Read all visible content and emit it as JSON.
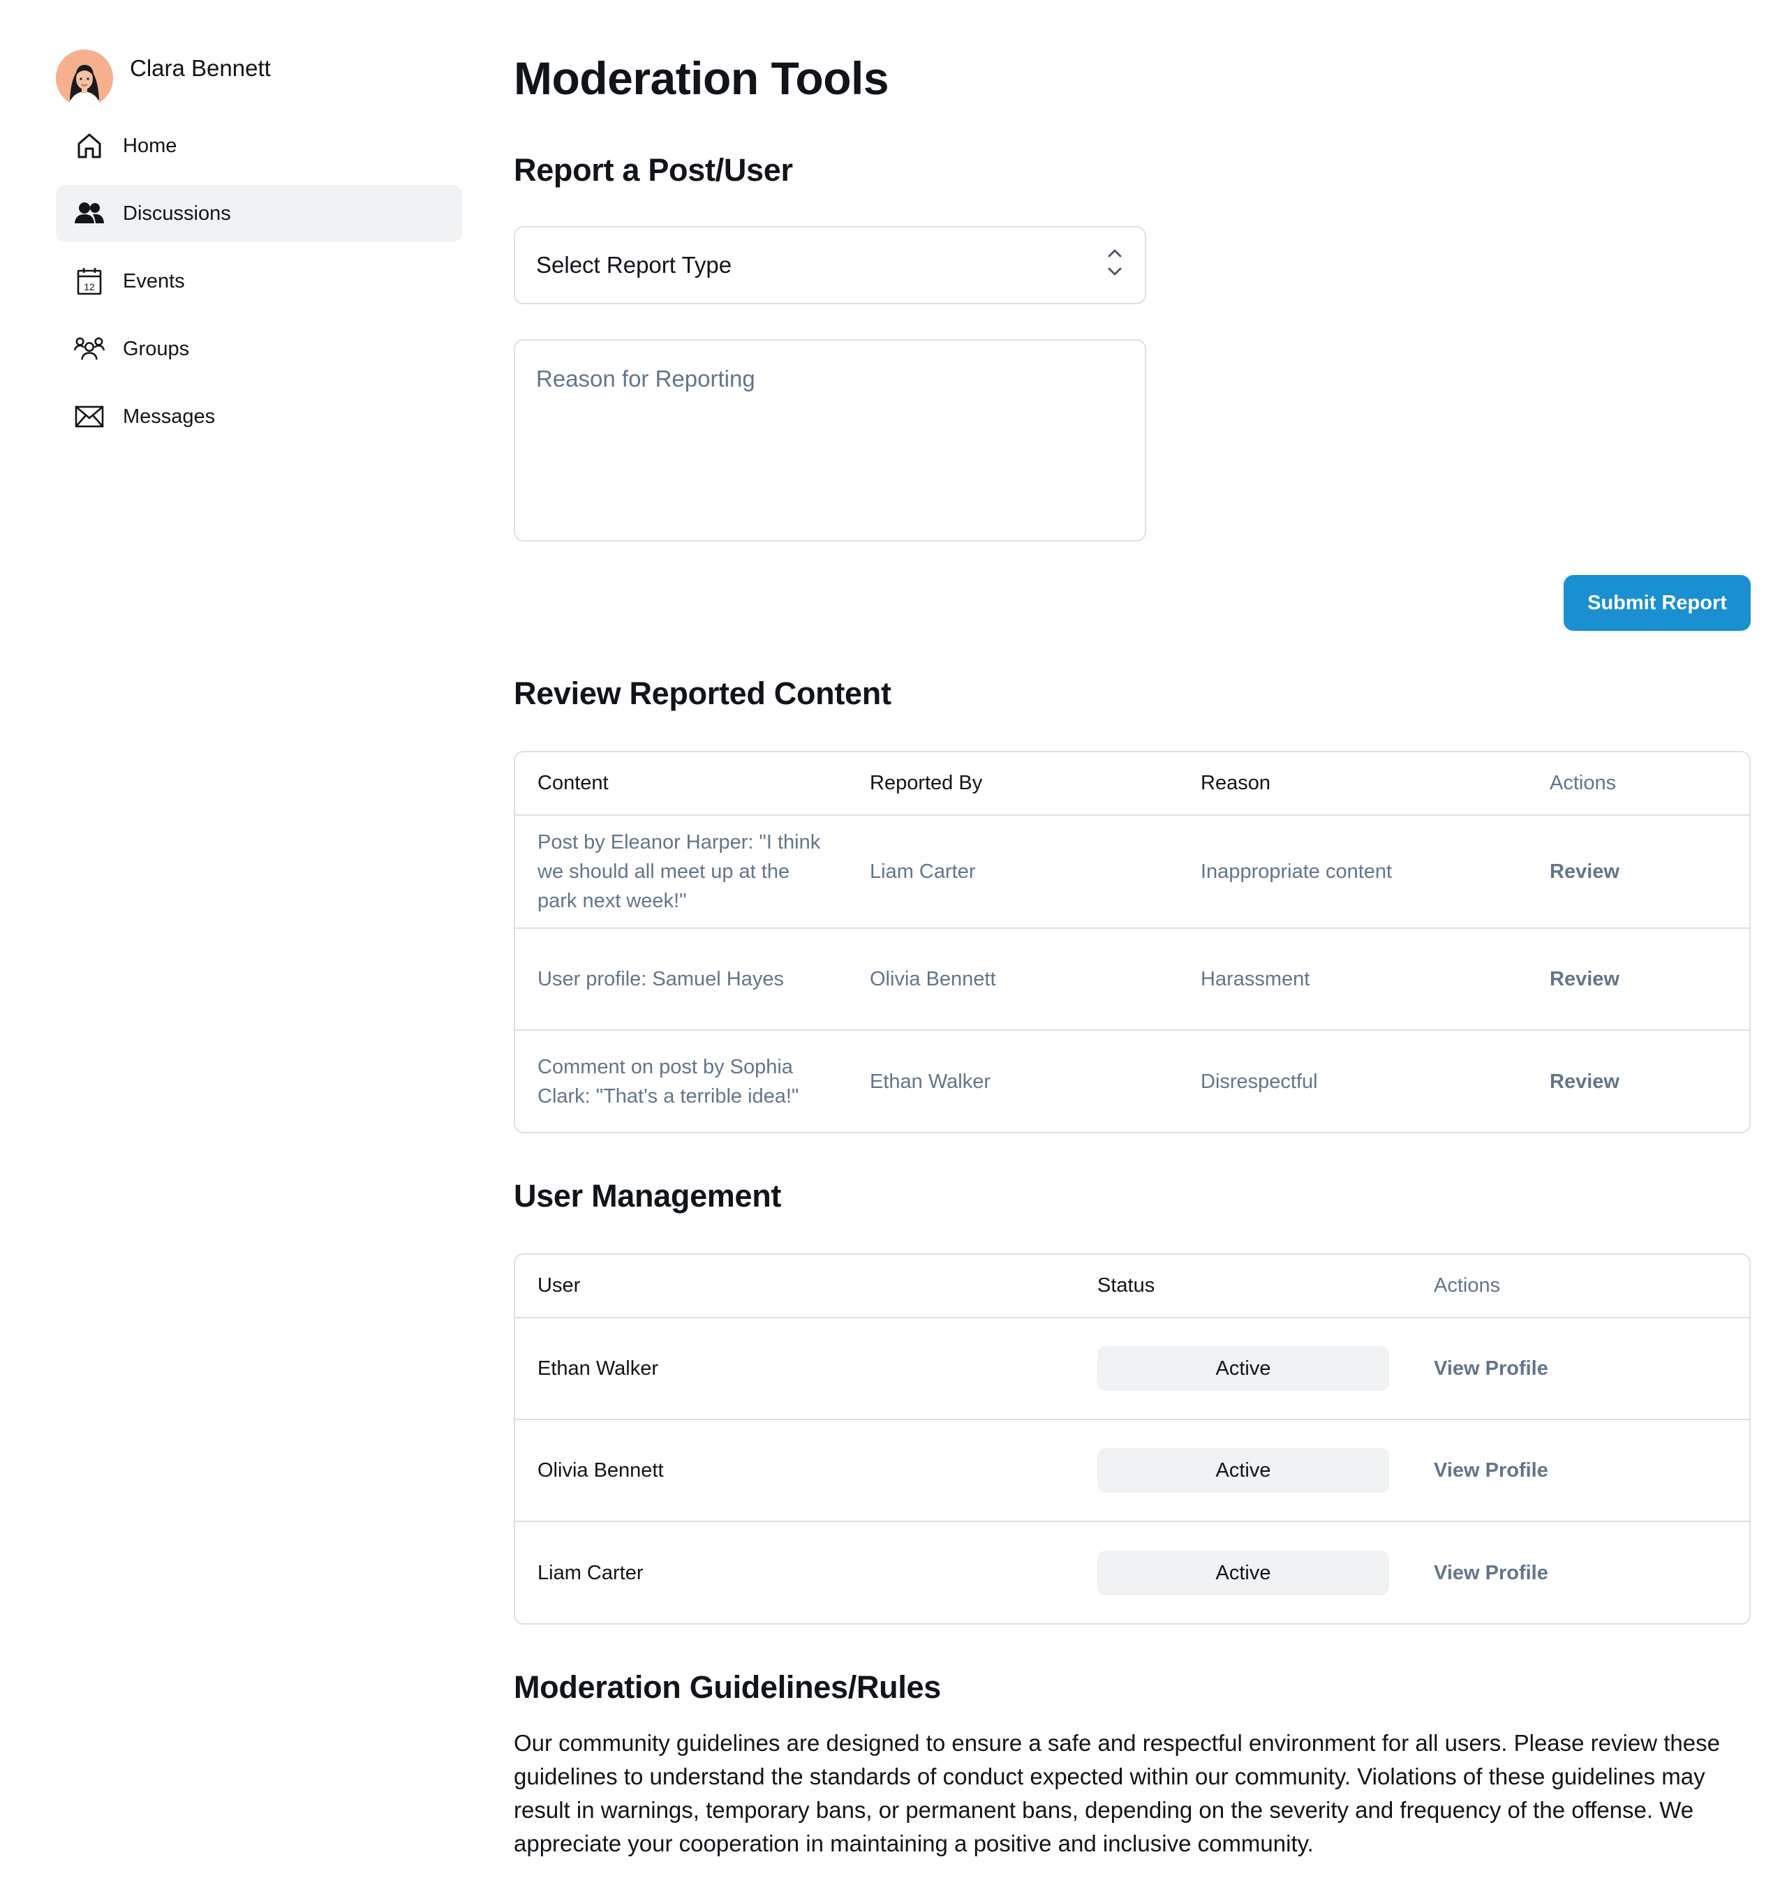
{
  "sidebar": {
    "user_name": "Clara Bennett",
    "items": [
      {
        "label": "Home",
        "icon": "home-icon"
      },
      {
        "label": "Discussions",
        "icon": "users-icon",
        "active": true
      },
      {
        "label": "Events",
        "icon": "calendar-icon",
        "icon_text": "12"
      },
      {
        "label": "Groups",
        "icon": "groups-icon"
      },
      {
        "label": "Messages",
        "icon": "mail-icon"
      }
    ]
  },
  "main": {
    "title": "Moderation Tools",
    "report": {
      "heading": "Report a Post/User",
      "select_value": "Select Report Type",
      "reason_placeholder": "Reason for Reporting",
      "submit_label": "Submit Report"
    },
    "review": {
      "heading": "Review Reported Content",
      "columns": [
        "Content",
        "Reported By",
        "Reason",
        "Actions"
      ],
      "rows": [
        {
          "content": "Post by Eleanor Harper: \"I think we should all meet up at the park next week!\"",
          "reported_by": "Liam Carter",
          "reason": "Inappropriate content",
          "action": "Review"
        },
        {
          "content": "User profile: Samuel Hayes",
          "reported_by": "Olivia Bennett",
          "reason": "Harassment",
          "action": "Review"
        },
        {
          "content": "Comment on post by Sophia Clark: \"That's a terrible idea!\"",
          "reported_by": "Ethan Walker",
          "reason": "Disrespectful",
          "action": "Review"
        }
      ]
    },
    "users": {
      "heading": "User Management",
      "columns": [
        "User",
        "Status",
        "Actions"
      ],
      "rows": [
        {
          "user": "Ethan Walker",
          "status": "Active",
          "action": "View Profile"
        },
        {
          "user": "Olivia Bennett",
          "status": "Active",
          "action": "View Profile"
        },
        {
          "user": "Liam Carter",
          "status": "Active",
          "action": "View Profile"
        }
      ]
    },
    "guidelines": {
      "heading": "Moderation Guidelines/Rules",
      "text": "Our community guidelines are designed to ensure a safe and respectful environment for all users. Please review these guidelines to understand the standards of conduct expected within our community. Violations of these guidelines may result in warnings, temporary bans, or permanent bans, depending on the severity and frequency of the offense. We appreciate your cooperation in maintaining a positive and inclusive community."
    }
  },
  "colors": {
    "accent": "#1a8fd1",
    "muted_text": "#637588",
    "border": "#dce0e5",
    "active_nav_bg": "#f0f2f4"
  }
}
